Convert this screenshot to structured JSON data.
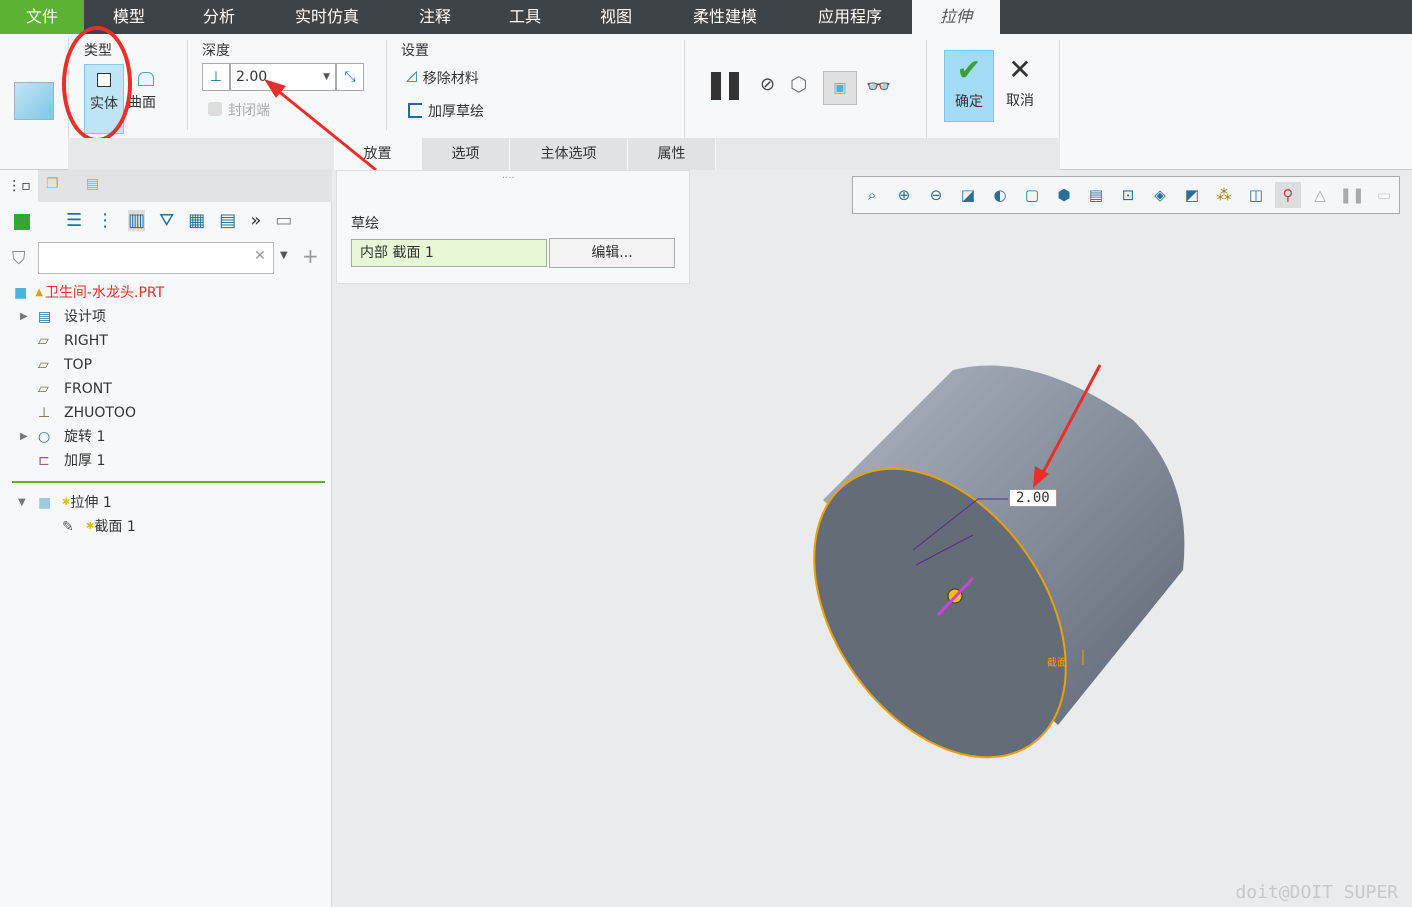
{
  "menu": [
    "文件",
    "模型",
    "分析",
    "实时仿真",
    "注释",
    "工具",
    "视图",
    "柔性建模",
    "应用程序",
    "拉伸"
  ],
  "ribbon": {
    "type_group": "类型",
    "solid": "实体",
    "surface": "曲面",
    "depth_group": "深度",
    "depth_value": "2.00",
    "capped_ends": "封闭端",
    "settings_group": "设置",
    "remove_material": "移除材料",
    "thicken_sketch": "加厚草绘",
    "ok": "确定",
    "cancel": "取消",
    "tabs": [
      "放置",
      "选项",
      "主体选项",
      "属性"
    ]
  },
  "placement_panel": {
    "label": "草绘",
    "section": "内部 截面 1",
    "edit_button": "编辑..."
  },
  "tree": {
    "search_placeholder": "",
    "root": "卫生间-水龙头.PRT",
    "items": [
      "设计项",
      "RIGHT",
      "TOP",
      "FRONT",
      "ZHUOTOO",
      "旋转 1",
      "加厚 1"
    ],
    "insert": [
      "拉伸 1",
      "截面 1"
    ]
  },
  "viewport": {
    "dimension": "2.00",
    "section_label": "截面"
  },
  "watermark": "doit@DOIT SUPER",
  "colors": {
    "accent": "#5cb233",
    "menubar": "#3d4347",
    "annotation": "#e8302a",
    "edge": "#f0a000"
  }
}
